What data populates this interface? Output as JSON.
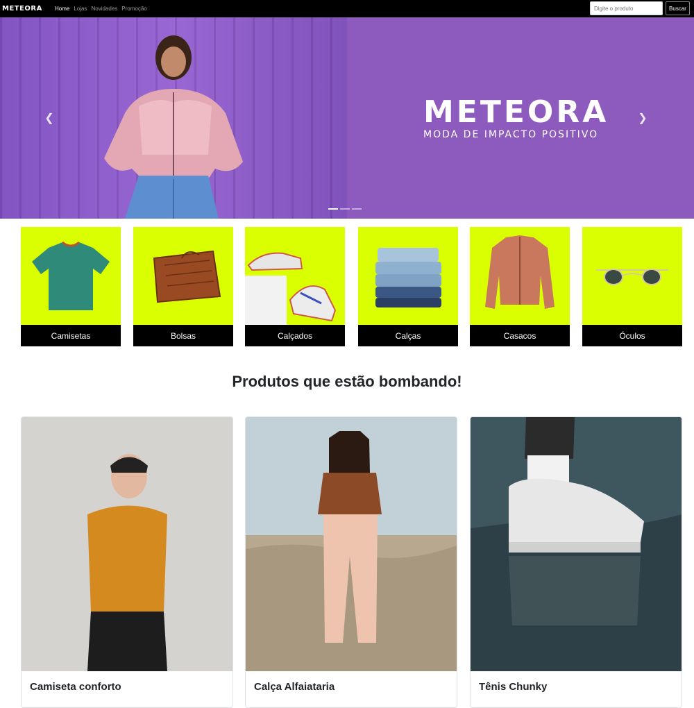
{
  "navbar": {
    "brand": "METEORA",
    "links": [
      "Home",
      "Lojas",
      "Novidades",
      "Promoção"
    ],
    "search_placeholder": "Digite o produto",
    "search_button": "Buscar"
  },
  "hero": {
    "logo_word": "METEORA",
    "tagline": "MODA DE IMPACTO POSITIVO",
    "prev_icon": "chevron-left-icon",
    "next_icon": "chevron-right-icon",
    "slide_count": 3,
    "active_slide": 1
  },
  "categories": [
    {
      "label": "Camisetas",
      "icon": "tshirt-icon"
    },
    {
      "label": "Bolsas",
      "icon": "bag-icon"
    },
    {
      "label": "Calçados",
      "icon": "sneaker-icon"
    },
    {
      "label": "Calças",
      "icon": "jeans-icon"
    },
    {
      "label": "Casacos",
      "icon": "jacket-icon"
    },
    {
      "label": "Óculos",
      "icon": "sunglasses-icon"
    }
  ],
  "section_title": "Produtos que estão bombando!",
  "products": [
    {
      "title": "Camiseta conforto"
    },
    {
      "title": "Calça Alfaiataria"
    },
    {
      "title": "Tênis Chunky"
    }
  ],
  "colors": {
    "navbar_bg": "#000000",
    "hero_bg": "#8c5bbd",
    "category_bg": "#d9ff00",
    "category_label_bg": "#000000"
  }
}
